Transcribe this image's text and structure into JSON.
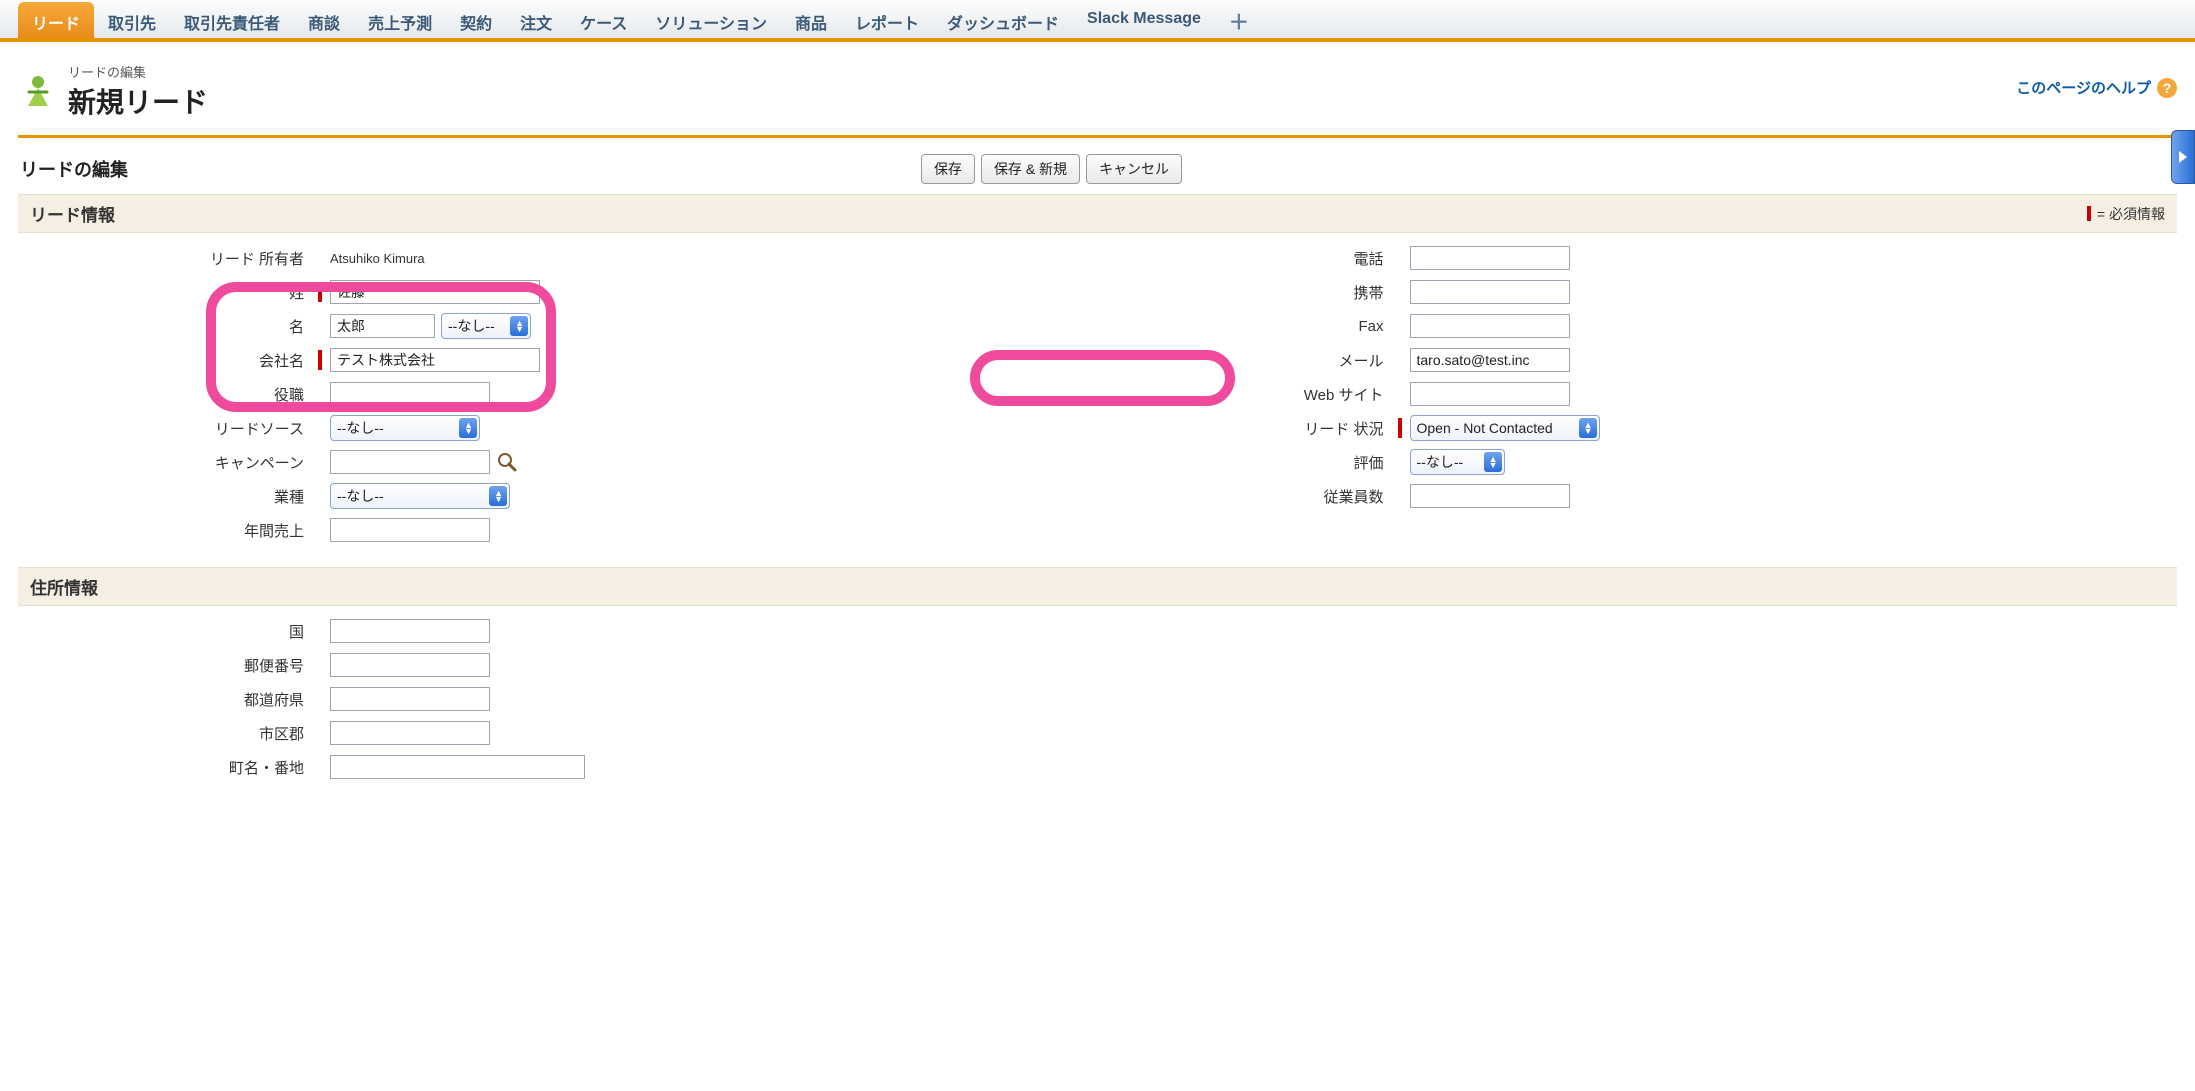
{
  "tabs": [
    {
      "label": "リード",
      "active": true
    },
    {
      "label": "取引先"
    },
    {
      "label": "取引先責任者"
    },
    {
      "label": "商談"
    },
    {
      "label": "売上予測"
    },
    {
      "label": "契約"
    },
    {
      "label": "注文"
    },
    {
      "label": "ケース"
    },
    {
      "label": "ソリューション"
    },
    {
      "label": "商品"
    },
    {
      "label": "レポート"
    },
    {
      "label": "ダッシュボード"
    },
    {
      "label": "Slack Message"
    }
  ],
  "tab_plus": "＋",
  "header": {
    "eyebrow": "リードの編集",
    "title": "新規リード",
    "help_text": "このページのヘルプ",
    "help_symbol": "?"
  },
  "actions": {
    "section_label": "リードの編集",
    "save": "保存",
    "save_new": "保存 & 新規",
    "cancel": "キャンセル"
  },
  "panel_lead": {
    "title": "リード情報",
    "required_note": "= 必須情報"
  },
  "fields": {
    "owner_label": "リード 所有者",
    "owner_value": "Atsuhiko Kimura",
    "lastname_label": "姓",
    "lastname_value": "佐藤",
    "firstname_label": "名",
    "firstname_value": "太郎",
    "salutation_value": "--なし--",
    "company_label": "会社名",
    "company_value": "テスト株式会社",
    "title_label": "役職",
    "title_value": "",
    "leadsource_label": "リードソース",
    "leadsource_value": "--なし--",
    "campaign_label": "キャンペーン",
    "campaign_value": "",
    "industry_label": "業種",
    "industry_value": "--なし--",
    "revenue_label": "年間売上",
    "revenue_value": "",
    "phone_label": "電話",
    "phone_value": "",
    "mobile_label": "携帯",
    "mobile_value": "",
    "fax_label": "Fax",
    "fax_value": "",
    "email_label": "メール",
    "email_value": "taro.sato@test.inc",
    "website_label": "Web サイト",
    "website_value": "",
    "status_label": "リード 状況",
    "status_value": "Open - Not Contacted",
    "rating_label": "評価",
    "rating_value": "--なし--",
    "employees_label": "従業員数",
    "employees_value": ""
  },
  "panel_address": {
    "title": "住所情報"
  },
  "address": {
    "country_label": "国",
    "country_value": "",
    "zip_label": "郵便番号",
    "zip_value": "",
    "state_label": "都道府県",
    "state_value": "",
    "city_label": "市区郡",
    "city_value": "",
    "street_label": "町名・番地",
    "street_value": ""
  }
}
